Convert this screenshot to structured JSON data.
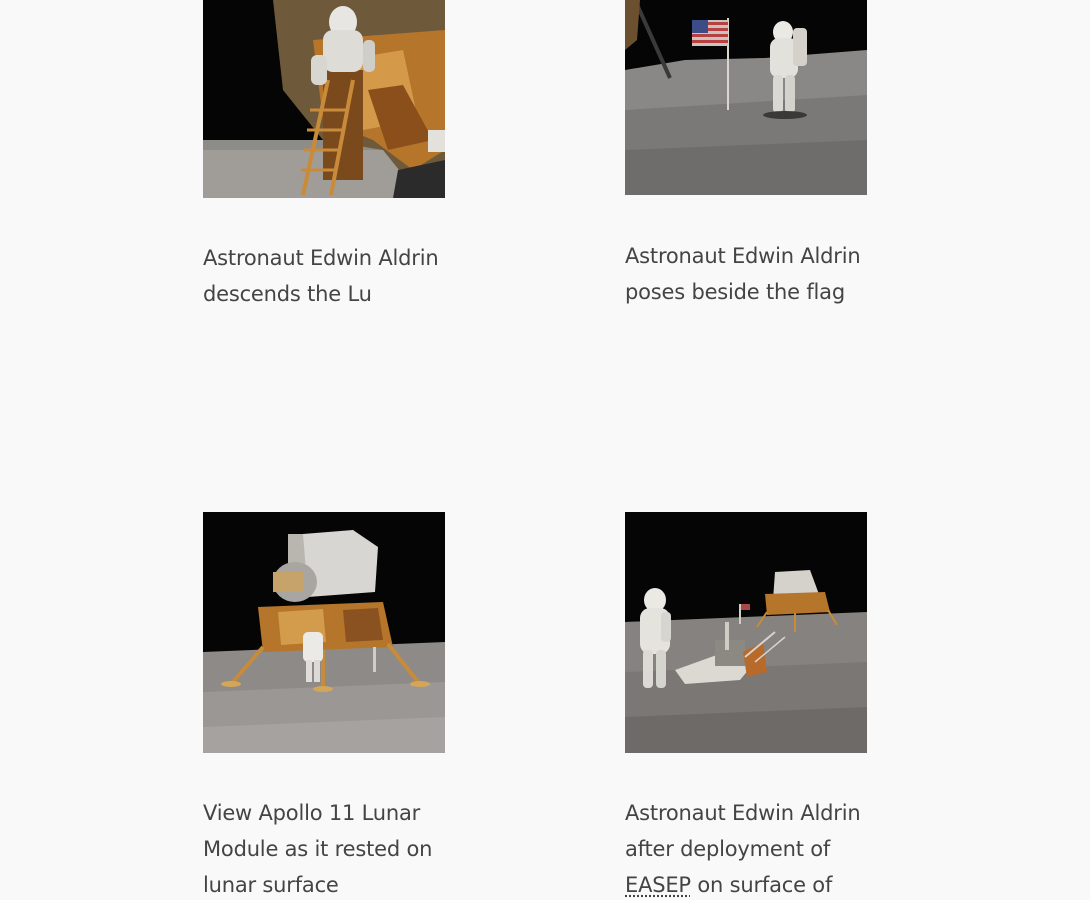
{
  "gallery": {
    "items": [
      {
        "caption": "Astronaut Edwin Aldrin descends the Lu",
        "image_icon": "lunar-module-ladder-photo-icon"
      },
      {
        "caption": "Astronaut Edwin Aldrin poses beside the flag",
        "image_icon": "astronaut-flag-photo-icon"
      },
      {
        "caption": "View Apollo 11 Lunar Module as it rested on lunar surface",
        "image_icon": "lunar-module-surface-photo-icon"
      },
      {
        "caption_before": "Astronaut Edwin Aldrin after deployment of",
        "caption_abbr": "EASEP",
        "caption_after": "on surface of",
        "image_icon": "easep-deployment-photo-icon"
      }
    ]
  },
  "colors": {
    "background": "#f9f9f9",
    "text": "#444444",
    "space": "#050505",
    "moon_surface": "#8a8886",
    "gold_foil": "#b5752a"
  }
}
